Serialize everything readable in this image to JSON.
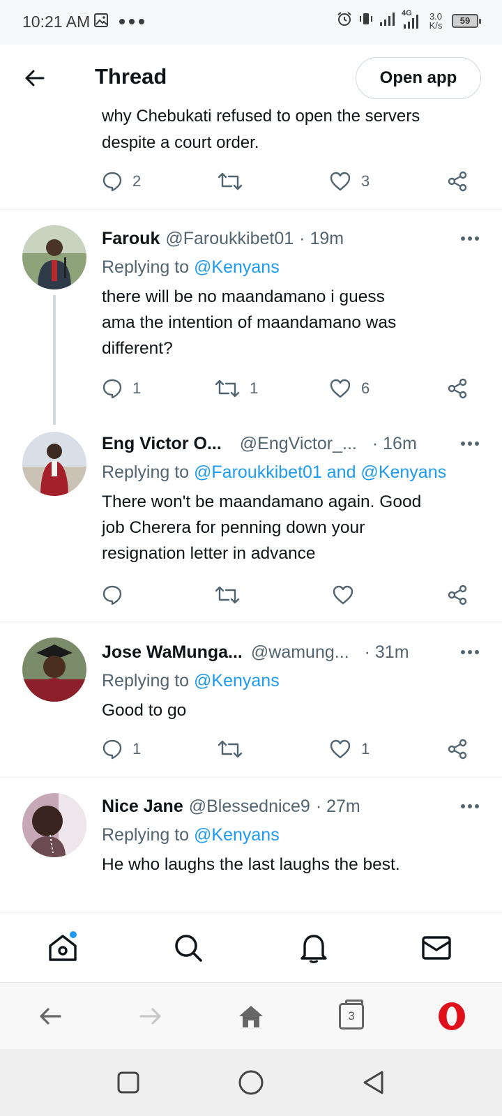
{
  "status_bar": {
    "time": "10:21 AM",
    "network_label": "4G",
    "speed_value": "3.0",
    "speed_unit": "K/s",
    "battery": "59"
  },
  "header": {
    "title": "Thread",
    "open_app_label": "Open app"
  },
  "partial_tweet": {
    "text_line1": "why Chebukati refused to open the servers",
    "text_line2": "despite a court order.",
    "replies": "2",
    "retweets": "",
    "likes": "3"
  },
  "tweets": [
    {
      "name": "Farouk",
      "handle": "@Faroukkibet01",
      "time": "· 19m",
      "replying_prefix": "Replying to ",
      "replying_to": "@Kenyans",
      "text_lines": [
        "there will be no maandamano i guess",
        "ama the intention of maandamano was",
        "different?"
      ],
      "replies": "1",
      "retweets": "1",
      "likes": "6"
    },
    {
      "name": "Eng Victor O...",
      "handle": "@EngVictor_...",
      "time": "· 16m",
      "replying_prefix": "Replying to ",
      "replying_to": "@Faroukkibet01 and @Kenyans",
      "text_lines": [
        "There won't be maandamano again. Good",
        "job Cherera for penning down your",
        "resignation letter in advance"
      ],
      "replies": "",
      "retweets": "",
      "likes": ""
    },
    {
      "name": "Jose WaMunga...",
      "handle": "@wamung...",
      "time": "· 31m",
      "replying_prefix": "Replying to ",
      "replying_to": "@Kenyans",
      "text_lines": [
        "Good to go"
      ],
      "replies": "1",
      "retweets": "",
      "likes": "1"
    },
    {
      "name": "Nice Jane",
      "handle": "@Blessednice9",
      "time": "· 27m",
      "replying_prefix": "Replying to ",
      "replying_to": "@Kenyans",
      "text_lines": [
        "He who laughs the last laughs the best."
      ]
    }
  ],
  "tab_bar": {
    "items": [
      "home-icon",
      "search-icon",
      "bell-icon",
      "mail-icon"
    ]
  },
  "browser_bar": {
    "tab_count": "3"
  },
  "colors": {
    "accent": "#1d9bf0",
    "secondary_text": "#536471",
    "opera_red": "#e0101a"
  }
}
